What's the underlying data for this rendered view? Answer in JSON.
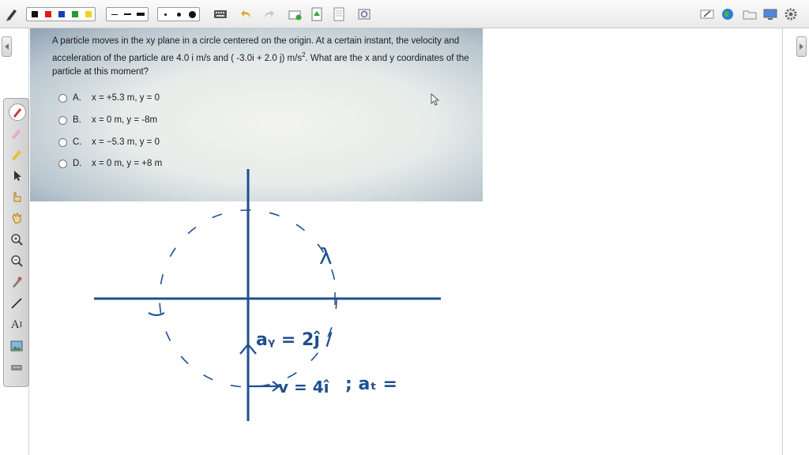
{
  "toolbar": {
    "icons": [
      "pen-icon",
      "color-black",
      "color-red",
      "color-blue",
      "color-green",
      "color-yellow",
      "line-thin",
      "line-medium",
      "line-thick",
      "dot-small",
      "dot-medium",
      "dot-large",
      "keyboard-icon",
      "undo-icon",
      "redo-icon",
      "new-page-icon",
      "document-icon",
      "blank-page-icon",
      "image-icon",
      "draw-area-icon",
      "globe-icon",
      "folder-icon",
      "screen-icon",
      "settings-icon"
    ],
    "colors": {
      "black": "#111111",
      "red": "#e01b1b",
      "blue": "#1d3fb0",
      "green": "#2a9a2a",
      "yellow": "#f2d21b"
    }
  },
  "question": {
    "text_part1": "A particle moves in the xy plane in a circle centered on the origin. At a certain instant, the velocity and acceleration of the particle are 4.0 i m/s and  ( -3.0i + 2.0 j) m/s",
    "superscript": "2",
    "text_part2": ". What are the x and y coordinates of the particle at this moment?",
    "options": [
      {
        "letter": "A.",
        "text": "x = +5.3 m, y = 0"
      },
      {
        "letter": "B.",
        "text": "x = 0 m, y = -8m"
      },
      {
        "letter": "C.",
        "text": "x = −5.3 m, y = 0"
      },
      {
        "letter": "D.",
        "text": "x = 0 m, y = +8 m"
      }
    ]
  },
  "annotations": {
    "ar_label": "aᵧ = 2ĵ /",
    "v_label": "v = 4î",
    "at_label": "; aₜ =",
    "lambda": "λ",
    "ink_color": "#1f4f8f"
  },
  "leftbar": {
    "tools": [
      "pen-tool-icon",
      "highlighter-icon",
      "eraser-icon",
      "pointer-icon",
      "select-hand-icon",
      "pan-hand-icon",
      "zoom-in-icon",
      "zoom-out-icon",
      "color-picker-icon",
      "line-tool-icon",
      "text-tool-icon",
      "insert-image-icon",
      "keyboard-tool-icon"
    ],
    "text_tool_label": "A"
  }
}
